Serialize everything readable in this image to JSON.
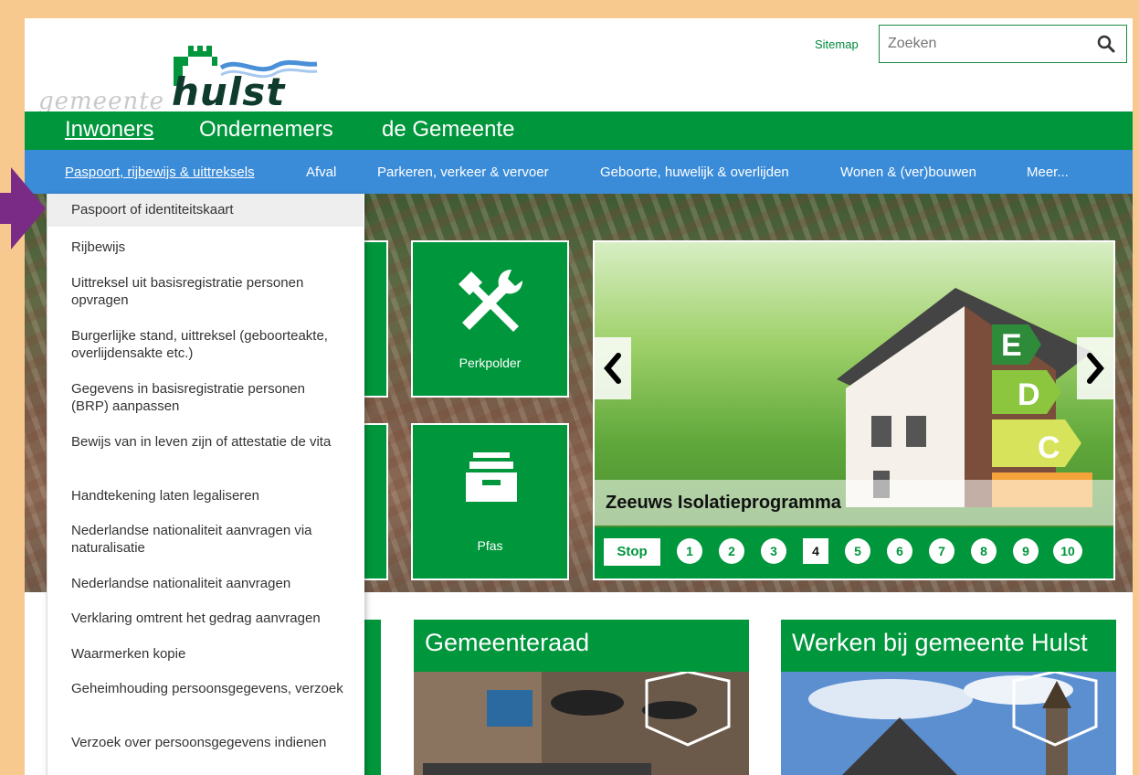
{
  "header": {
    "logo_prefix": "gemeente",
    "logo_name": "hulst",
    "sitemap": "Sitemap",
    "search_placeholder": "Zoeken"
  },
  "nav_primary": [
    "Inwoners",
    "Ondernemers",
    "de Gemeente"
  ],
  "nav_secondary": [
    "Paspoort, rijbewijs & uittreksels",
    "Afval",
    "Parkeren, verkeer & vervoer",
    "Geboorte, huwelijk & overlijden",
    "Wonen & (ver)bouwen",
    "Meer..."
  ],
  "dropdown": [
    "Paspoort of identiteitskaart",
    "Rijbewijs",
    "Uittreksel uit basisregistratie personen opvragen",
    "Burgerlijke stand, uittreksel (geboorteakte, overlijdensakte etc.)",
    "Gegevens in basisregistratie personen (BRP) aanpassen",
    "Bewijs van in leven zijn of attestatie de vita",
    "Handtekening laten legaliseren",
    "Nederlandse nationaliteit aanvragen via naturalisatie",
    "Nederlandse nationaliteit aanvragen",
    "Verklaring omtrent het gedrag aanvragen",
    "Waarmerken kopie",
    "Geheimhouding persoonsgegevens, verzoek",
    "Verzoek over persoonsgegevens indienen"
  ],
  "tiles": [
    {
      "label": "Perkpolder",
      "icon": "tools-icon"
    },
    {
      "label": "Pfas",
      "icon": "archive-tray-icon"
    }
  ],
  "slider": {
    "caption": "Zeeuws Isolatieprogramma",
    "stop_label": "Stop",
    "pages": [
      "1",
      "2",
      "3",
      "4",
      "5",
      "6",
      "7",
      "8",
      "9",
      "10"
    ],
    "current": "4",
    "energy_labels": [
      "E",
      "D",
      "C"
    ]
  },
  "cards": [
    "Gemeenteraad",
    "Werken bij gemeente Hulst"
  ],
  "colors": {
    "green": "#00963c",
    "blue": "#3a8bd8",
    "frame": "#f8c98e",
    "arrow": "#7a2b86"
  }
}
